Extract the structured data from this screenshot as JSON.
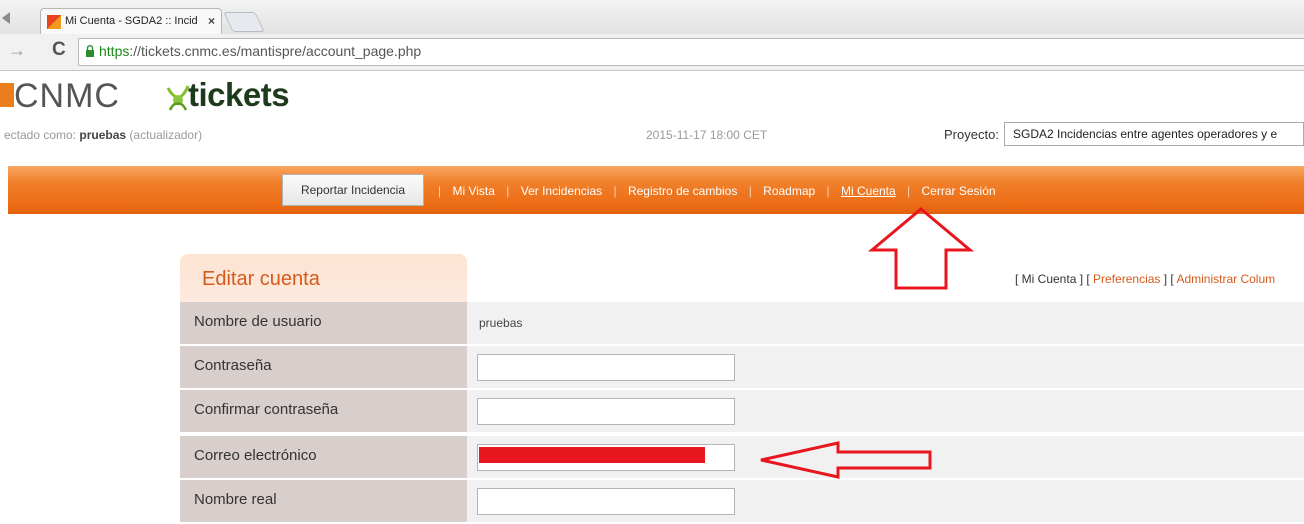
{
  "browser": {
    "tab_title": "Mi Cuenta - SGDA2 :: Incid",
    "tab_close": "×",
    "url_https": "https",
    "url_rest": "://tickets.cnmc.es/mantispre/account_page.php"
  },
  "header": {
    "logo_cnmc": "CNMC",
    "logo_tickets": "tickets",
    "logged_in_prefix": "ectado como: ",
    "user": "pruebas",
    "role": " (actualizador)",
    "server_time": "2015-11-17 18:00 CET",
    "project_label": "Proyecto:",
    "project_value": "SGDA2 Incidencias entre agentes operadores y e"
  },
  "menu": {
    "report_button": "Reportar Incidencia",
    "separator": "|",
    "items": [
      "Mi Vista",
      "Ver Incidencias",
      "Registro de cambios",
      "Roadmap",
      "Mi Cuenta",
      "Cerrar Sesión"
    ]
  },
  "account": {
    "title": "Editar cuenta",
    "links": {
      "open": "[ ",
      "my_account": "Mi Cuenta",
      "mid1": " ] [ ",
      "preferences": "Preferencias",
      "mid2": " ] [ ",
      "manage_columns": "Administrar Colum"
    },
    "fields": {
      "username_label": "Nombre de usuario",
      "username_value": "pruebas",
      "password_label": "Contraseña",
      "password_value": "",
      "confirm_label": "Confirmar contraseña",
      "confirm_value": "",
      "email_label": "Correo electrónico",
      "email_value": "",
      "realname_label": "Nombre real",
      "realname_value": ""
    }
  },
  "colors": {
    "menu_orange": "#ec6d16",
    "title_orange": "#d55b1c",
    "annotation_red": "#e8161e",
    "label_bg": "#d8cecb"
  }
}
